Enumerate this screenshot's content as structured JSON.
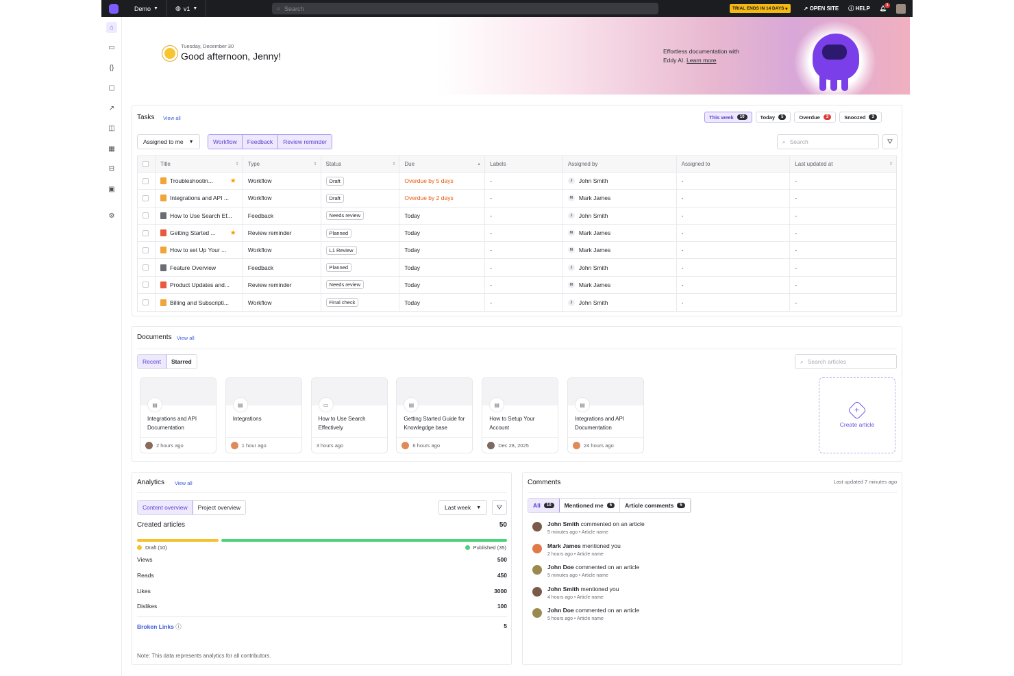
{
  "topbar": {
    "workspace": "Demo",
    "version": "v1",
    "search_placeholder": "Search",
    "trial": "TRIAL ENDS IN 14 DAYS",
    "open_site": "OPEN SITE",
    "help": "HELP",
    "notifications": "3"
  },
  "sidebar": {
    "icons": [
      "home-icon",
      "book-icon",
      "code-braces-icon",
      "chat-icon",
      "analytics-icon",
      "docs-compare-icon",
      "apps-icon",
      "layout-icon",
      "devices-icon",
      "settings-icon"
    ]
  },
  "hero": {
    "date": "Tuesday, December 30",
    "greeting": "Good afternoon, Jenny!",
    "eddy_line1": "Effortless documentation with",
    "eddy_line2": "Eddy AI.",
    "learn_more": "Learn more"
  },
  "tasks": {
    "title": "Tasks",
    "view_all": "View all",
    "filters": [
      {
        "label": "This week",
        "count": "10",
        "active": true,
        "red": false
      },
      {
        "label": "Today",
        "count": "5",
        "active": false,
        "red": false
      },
      {
        "label": "Overdue",
        "count": "3",
        "active": false,
        "red": true
      },
      {
        "label": "Snoozed",
        "count": "3",
        "active": false,
        "red": false
      }
    ],
    "assigned_dropdown": "Assigned to me",
    "types": [
      "Workflow",
      "Feedback",
      "Review reminder"
    ],
    "search_placeholder": "Search",
    "columns": [
      "Title",
      "Type",
      "Status",
      "Due",
      "Labels",
      "Assigned by",
      "Assigned to",
      "Last updated at"
    ],
    "rows": [
      {
        "title": "Troubleshootin...",
        "starred": true,
        "icon": "orange",
        "type": "Workflow",
        "status": "Draft",
        "due": "Overdue by 5 days",
        "overdue": true,
        "labels": "-",
        "by": "John Smith",
        "by_initial": "J",
        "to": "-",
        "updated": "-"
      },
      {
        "title": "Integrations and API ...",
        "starred": false,
        "icon": "orange",
        "type": "Workflow",
        "status": "Draft",
        "due": "Overdue by 2 days",
        "overdue": true,
        "labels": "-",
        "by": "Mark James",
        "by_initial": "M",
        "to": "-",
        "updated": "-"
      },
      {
        "title": "How to Use Search Ef...",
        "starred": false,
        "icon": "gray",
        "type": "Feedback",
        "status": "Needs review",
        "due": "Today",
        "overdue": false,
        "labels": "-",
        "by": "John Smith",
        "by_initial": "J",
        "to": "-",
        "updated": "-"
      },
      {
        "title": "Getting Started ...",
        "starred": true,
        "icon": "red",
        "type": "Review reminder",
        "status": "Planned",
        "due": "Today",
        "overdue": false,
        "labels": "-",
        "by": "Mark James",
        "by_initial": "M",
        "to": "-",
        "updated": "-"
      },
      {
        "title": "How to set Up Your ...",
        "starred": false,
        "icon": "orange",
        "type": "Workflow",
        "status": "L1 Review",
        "due": "Today",
        "overdue": false,
        "labels": "-",
        "by": "Mark James",
        "by_initial": "M",
        "to": "-",
        "updated": "-"
      },
      {
        "title": "Feature Overview",
        "starred": false,
        "icon": "gray",
        "type": "Feedback",
        "status": "Planned",
        "due": "Today",
        "overdue": false,
        "labels": "-",
        "by": "John Smith",
        "by_initial": "J",
        "to": "-",
        "updated": "-"
      },
      {
        "title": "Product Updates and...",
        "starred": false,
        "icon": "red",
        "type": "Review reminder",
        "status": "Needs review",
        "due": "Today",
        "overdue": false,
        "labels": "-",
        "by": "Mark James",
        "by_initial": "M",
        "to": "-",
        "updated": "-"
      },
      {
        "title": "Billing and Subscripti...",
        "starred": false,
        "icon": "orange",
        "type": "Workflow",
        "status": "Final check",
        "due": "Today",
        "overdue": false,
        "labels": "-",
        "by": "John Smith",
        "by_initial": "J",
        "to": "-",
        "updated": "-"
      }
    ]
  },
  "documents": {
    "title": "Documents",
    "view_all": "View all",
    "tabs": [
      "Recent",
      "Starred"
    ],
    "search_placeholder": "Search articles",
    "cards": [
      {
        "title": "Integrations and API Documentation",
        "time": "2 hours ago",
        "icon": "doc"
      },
      {
        "title": "Integrations",
        "time": "1 hour ago",
        "icon": "doc"
      },
      {
        "title": "How to Use Search Effectively",
        "time": "3 hours ago",
        "icon": "folder"
      },
      {
        "title": "Getting Started Guide for Knowlegdge base",
        "time": "6 hours ago",
        "icon": "doc"
      },
      {
        "title": "How to Setup Your Account",
        "time": "Dec 28, 2025",
        "icon": "doc"
      },
      {
        "title": "Integrations and API Documentation",
        "time": "24 hours ago",
        "icon": "doc"
      }
    ],
    "create_label": "Create article"
  },
  "analytics": {
    "title": "Analytics",
    "view_all": "View all",
    "tabs": [
      "Content overview",
      "Project overview"
    ],
    "range": "Last week",
    "created_label": "Created articles",
    "created_value": "50",
    "draft_label": "Draft (10)",
    "published_label": "Published (35)",
    "draft_count": 10,
    "published_count": 35,
    "colors": {
      "draft": "#f5c12e",
      "published": "#4cd37a"
    },
    "metrics": [
      {
        "label": "Views",
        "value": "500"
      },
      {
        "label": "Reads",
        "value": "450"
      },
      {
        "label": "Likes",
        "value": "3000"
      },
      {
        "label": "Dislikes",
        "value": "100"
      }
    ],
    "broken_links_label": "Broken Links",
    "broken_links_value": "5",
    "note": "Note: This data represents analytics for all contributors."
  },
  "comments": {
    "title": "Comments",
    "last_updated": "Last updated 7 minutes ago",
    "tabs": [
      {
        "label": "All",
        "count": "10"
      },
      {
        "label": "Mentioned me",
        "count": "5"
      },
      {
        "label": "Article comments",
        "count": "5"
      }
    ],
    "items": [
      {
        "name": "John Smith",
        "action": "commented on an article",
        "time": "5 minutes ago",
        "article": "Article name"
      },
      {
        "name": "Mark James",
        "action": "mentioned you",
        "time": "2 hours ago",
        "article": "Article name"
      },
      {
        "name": "John Doe",
        "action": "commented on an article",
        "time": "5 minutes ago",
        "article": "Article name"
      },
      {
        "name": "John Smith",
        "action": "mentioned you",
        "time": "4 hours ago",
        "article": "Article name"
      },
      {
        "name": "John Doe",
        "action": "commented on an article",
        "time": "5 hours ago",
        "article": "Article name"
      }
    ]
  }
}
